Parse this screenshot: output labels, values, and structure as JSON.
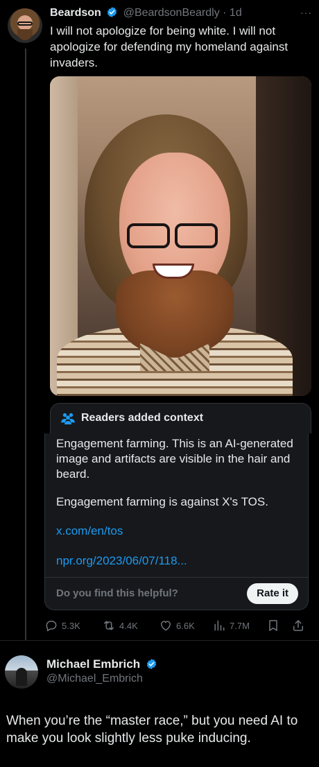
{
  "tweet": {
    "name": "Beardson",
    "handle": "@BeardsonBeardly",
    "time": "· 1d",
    "text": "I will not apologize for being white. I will not apologize for defending my homeland against invaders."
  },
  "context": {
    "title": "Readers added context",
    "note_p1": "Engagement farming. This is an AI-generated image and artifacts are visible in the hair and beard.",
    "note_p2": "Engagement farming is against X's TOS.",
    "link1": "x.com/en/tos",
    "link2": "npr.org/2023/06/07/118...",
    "helpful_prompt": "Do you find this helpful?",
    "rate_label": "Rate it"
  },
  "actions": {
    "replies": "5.3K",
    "reposts": "4.4K",
    "likes": "6.6K",
    "views": "7.7M"
  },
  "reply": {
    "name": "Michael Embrich",
    "handle": "@Michael_Embrich",
    "text": "When you’re the “master race,” but you need AI to make you look slightly less puke inducing."
  },
  "colors": {
    "background": "#000000",
    "text": "#e7e9ea",
    "muted": "#71767b",
    "link": "#1d9bf0",
    "verified": "#1d9bf0",
    "card": "#16181c"
  }
}
